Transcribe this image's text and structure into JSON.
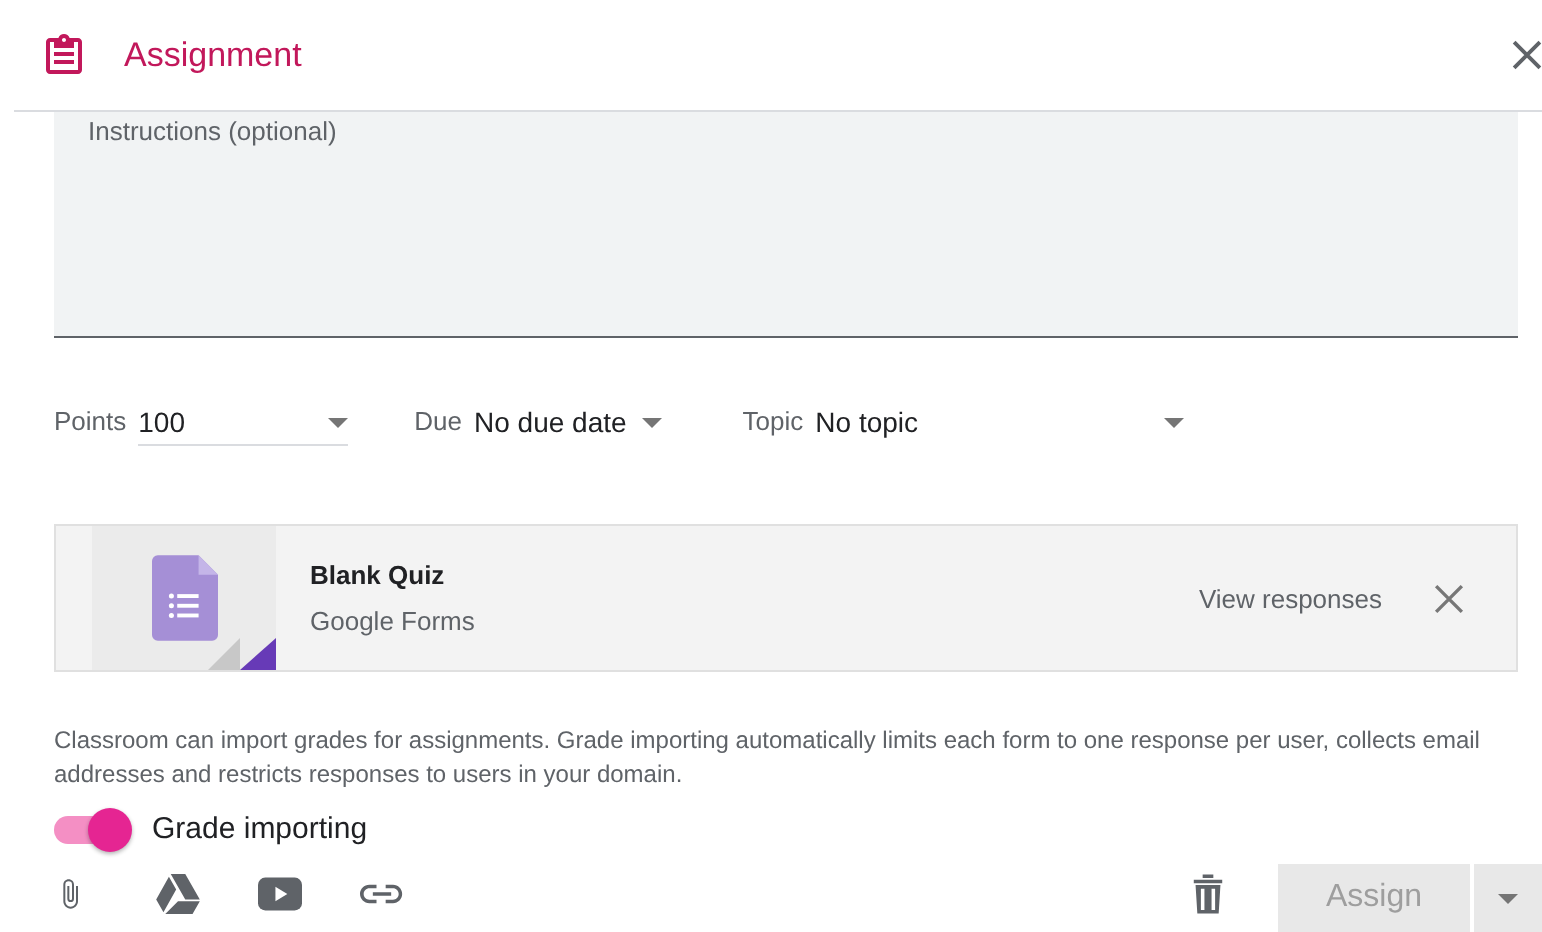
{
  "header": {
    "title": "Assignment"
  },
  "instructions": {
    "placeholder": "Instructions (optional)"
  },
  "fields": [
    {
      "label": "Points",
      "value": "100",
      "kind": "underlined"
    },
    {
      "label": "Due",
      "value": "No due date",
      "kind": "compact"
    },
    {
      "label": "Topic",
      "value": "No topic",
      "kind": "wide"
    }
  ],
  "attachment": {
    "title": "Blank Quiz",
    "subtitle": "Google Forms",
    "action": "View responses"
  },
  "notice": "Classroom can import grades for assignments. Grade importing automatically limits each form to one response per user, collects email addresses and restricts responses to users in your domain.",
  "grade_importing": {
    "label": "Grade importing",
    "on": true
  },
  "assign_button": {
    "label": "Assign",
    "disabled": true
  }
}
